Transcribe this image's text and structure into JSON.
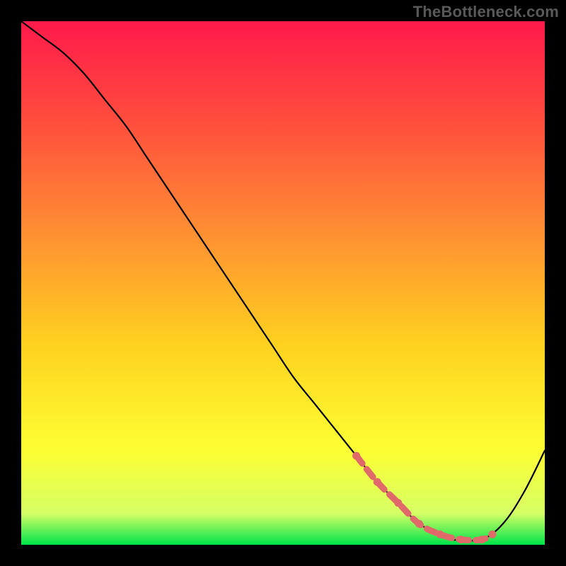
{
  "attribution": "TheBottleneck.com",
  "chart_data": {
    "type": "line",
    "title": "",
    "xlabel": "",
    "ylabel": "",
    "xlim": [
      0,
      100
    ],
    "ylim": [
      0,
      100
    ],
    "background_gradient": {
      "stops": [
        {
          "offset": 0.0,
          "color": "#ff1a4b"
        },
        {
          "offset": 0.18,
          "color": "#ff4a3e"
        },
        {
          "offset": 0.4,
          "color": "#ff8e33"
        },
        {
          "offset": 0.62,
          "color": "#ffd21f"
        },
        {
          "offset": 0.82,
          "color": "#fdff33"
        },
        {
          "offset": 0.94,
          "color": "#d6ff66"
        },
        {
          "offset": 1.0,
          "color": "#00e34a"
        }
      ]
    },
    "series": [
      {
        "name": "bottleneck-curve",
        "stroke": "#000000",
        "stroke_width": 2.2,
        "x": [
          0,
          4,
          8,
          12,
          16,
          20,
          24,
          28,
          32,
          36,
          40,
          44,
          48,
          52,
          56,
          60,
          64,
          68,
          72,
          76,
          80,
          82,
          84,
          88,
          92,
          96,
          100
        ],
        "y": [
          100,
          97,
          94,
          90,
          85,
          80,
          74,
          68,
          62,
          56,
          50,
          44,
          38,
          32,
          27,
          22,
          17,
          12,
          8,
          4,
          2,
          1,
          1,
          1,
          4,
          10,
          18
        ]
      }
    ],
    "highlight": {
      "name": "optimal-range",
      "stroke": "#e06a6a",
      "stroke_width": 9,
      "dot_radius": 5.5,
      "x": [
        64,
        68,
        72,
        76,
        80,
        84,
        88,
        90
      ],
      "y": [
        17,
        12,
        8,
        4,
        2,
        1,
        1,
        2
      ]
    }
  }
}
